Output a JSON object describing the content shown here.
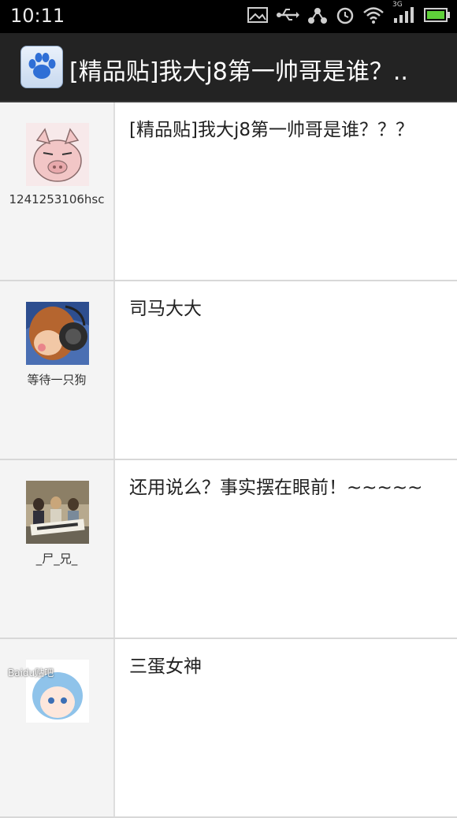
{
  "status_bar": {
    "time": "10:11",
    "network": "3G",
    "icons": [
      "image-icon",
      "usb-icon",
      "share-icon",
      "alarm-icon",
      "wifi-icon",
      "signal-icon",
      "battery-icon"
    ]
  },
  "action_bar": {
    "title": "[精品贴]我大j8第一帅哥是谁？..",
    "logo_icon": "baidu-paw-icon"
  },
  "posts": [
    {
      "username": "1241253106hsc",
      "content": "[精品贴]我大j8第一帅哥是谁？？？",
      "avatar": "pig-cartoon-avatar"
    },
    {
      "username": "等待一只狗",
      "content": "司马大大",
      "avatar": "headphone-girl-avatar"
    },
    {
      "username": "_尸_兄_",
      "content": "还用说么？事实摆在眼前！~~~~~",
      "avatar": "group-photo-avatar"
    },
    {
      "username": "",
      "content": "三蛋女神",
      "avatar": "anime-girl-avatar"
    }
  ],
  "watermark": "Baidu贴吧"
}
